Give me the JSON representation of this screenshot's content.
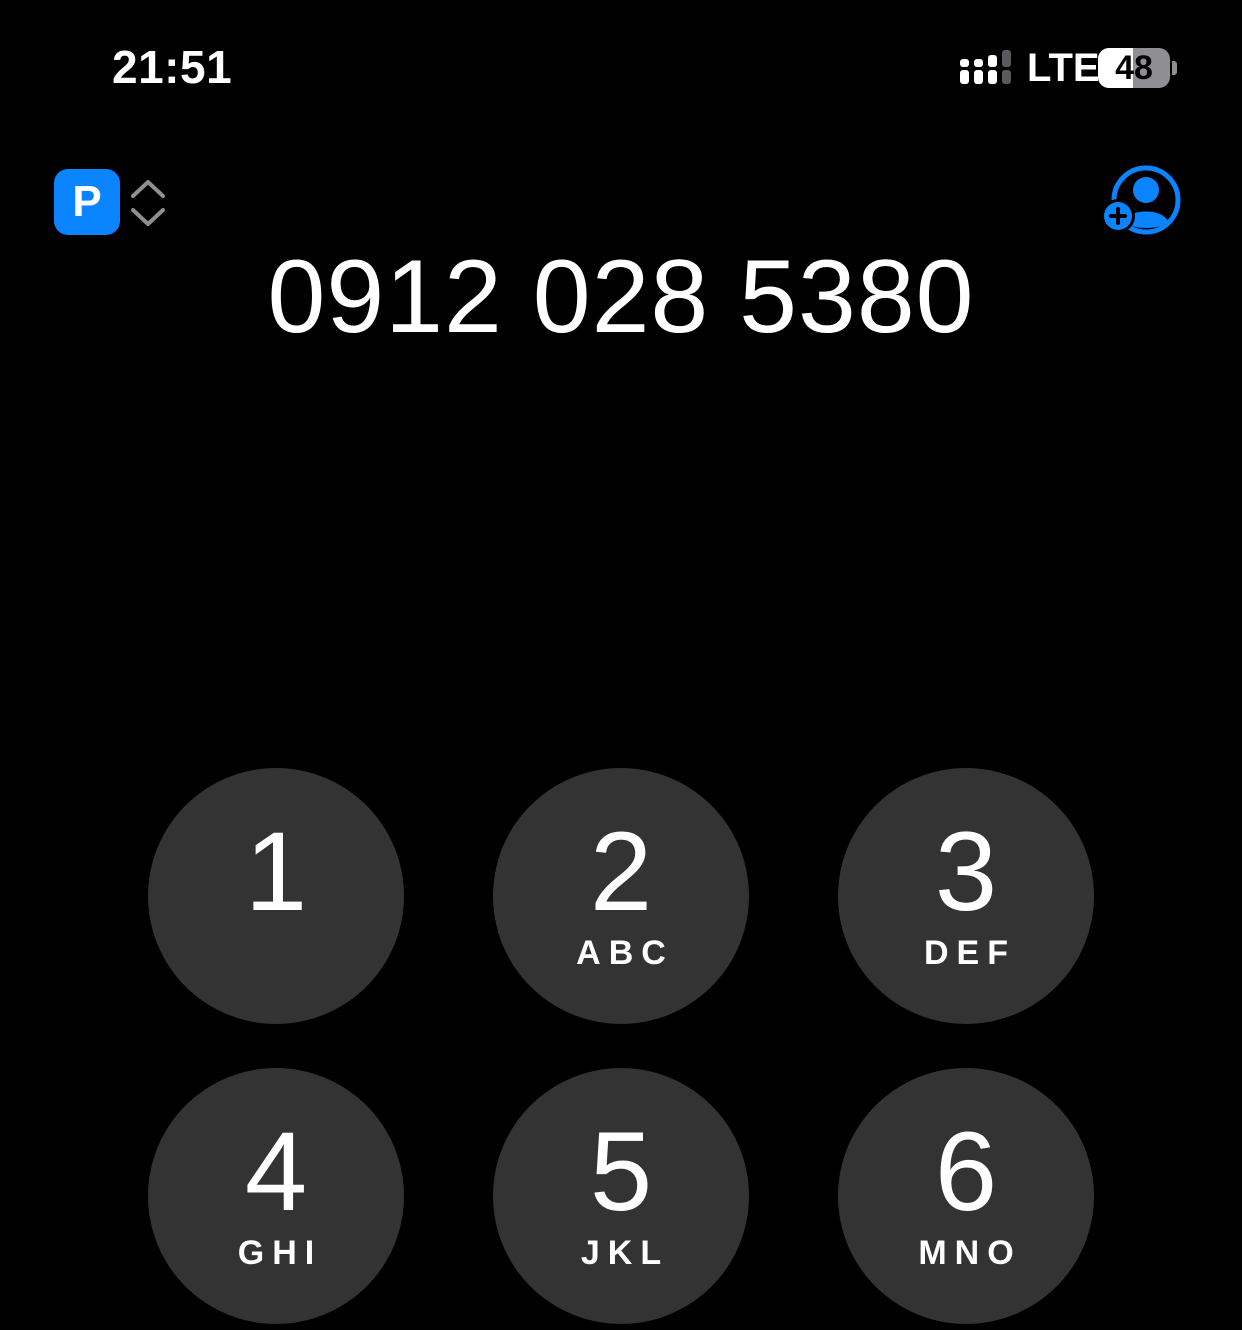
{
  "status_bar": {
    "time": "21:51",
    "network": "LTE",
    "battery_percent": 48,
    "battery_label": "48",
    "signal_icon": "signal-bars-icon"
  },
  "header": {
    "line_badge": "P",
    "line_switch_icon": "chevron-up-down-icon",
    "add_contact_icon": "add-contact-icon"
  },
  "display": {
    "number": "0912 028 5380"
  },
  "keypad": {
    "keys": [
      {
        "digit": "1",
        "letters": ""
      },
      {
        "digit": "2",
        "letters": "ABC"
      },
      {
        "digit": "3",
        "letters": "DEF"
      },
      {
        "digit": "4",
        "letters": "GHI"
      },
      {
        "digit": "5",
        "letters": "JKL"
      },
      {
        "digit": "6",
        "letters": "MNO"
      }
    ]
  },
  "colors": {
    "accent": "#0a84ff",
    "key_background": "#333333",
    "background": "#000000"
  }
}
